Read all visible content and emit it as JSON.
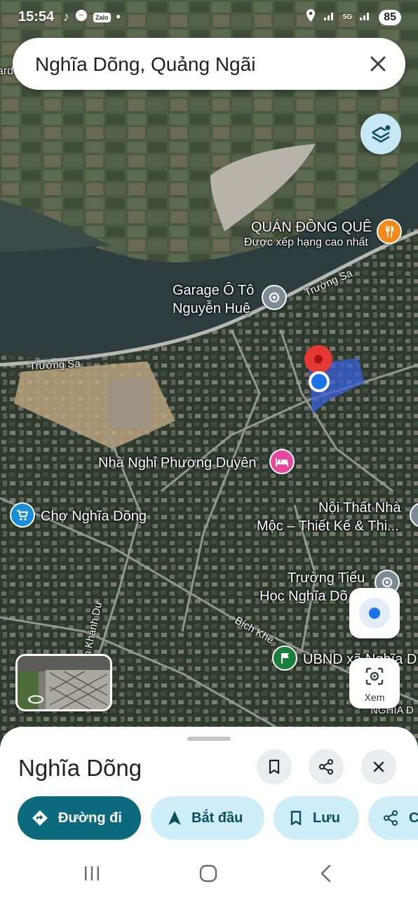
{
  "status_bar": {
    "time": "15:54",
    "app_icons": [
      "tiktok-icon",
      "messenger-icon",
      "zalo-icon"
    ],
    "zalo_label": "Zalo",
    "network": "5G",
    "battery": "85"
  },
  "search": {
    "query": "Nghĩa Dõng, Quảng Ngãi"
  },
  "map": {
    "edge_label": "ard",
    "roads": {
      "truong_sa_1": "Trường Sa",
      "truong_sa_2": "Trường Sa",
      "khanh_du": "n Khánh Dư",
      "bich_khe": "Bích Khê",
      "nghia_dung_road": "NGHĨA D"
    },
    "places": {
      "quan_dong_que": "QUÁN ĐỒNG QUÊ",
      "quan_dong_que_sub": "Được xếp hạng cao nhất",
      "garage_line1": "Garage Ô Tô",
      "garage_line2": "Nguyễn Huệ",
      "nha_nghi": "Nhà Nghỉ Phương Duyên",
      "cho": "Chợ Nghĩa Dõng",
      "noi_that_line1": "Nội Thất Nhà",
      "noi_that_line2": "Mộc – Thiết Kế & Thi...",
      "truong_line1": "Trường Tiểu",
      "truong_line2": "Học Nghĩa Dõ",
      "ubnd": "UBND xã Nghĩa D"
    }
  },
  "controls": {
    "view_label": "Xem"
  },
  "sheet": {
    "title": "Nghĩa Dõng",
    "actions": {
      "directions": "Đường đi",
      "start": "Bắt đầu",
      "save": "Lưu",
      "share": "C"
    }
  },
  "colors": {
    "primary_chip": "#0b6a7e",
    "secondary_chip": "#cdeef9",
    "pin_red": "#e53935",
    "location_blue": "#1a73e8",
    "poi_orange": "#f28a1b",
    "poi_pink": "#e8489b",
    "poi_blue": "#1a8ed8",
    "poi_gray": "#7e8b95",
    "poi_green": "#188038"
  }
}
